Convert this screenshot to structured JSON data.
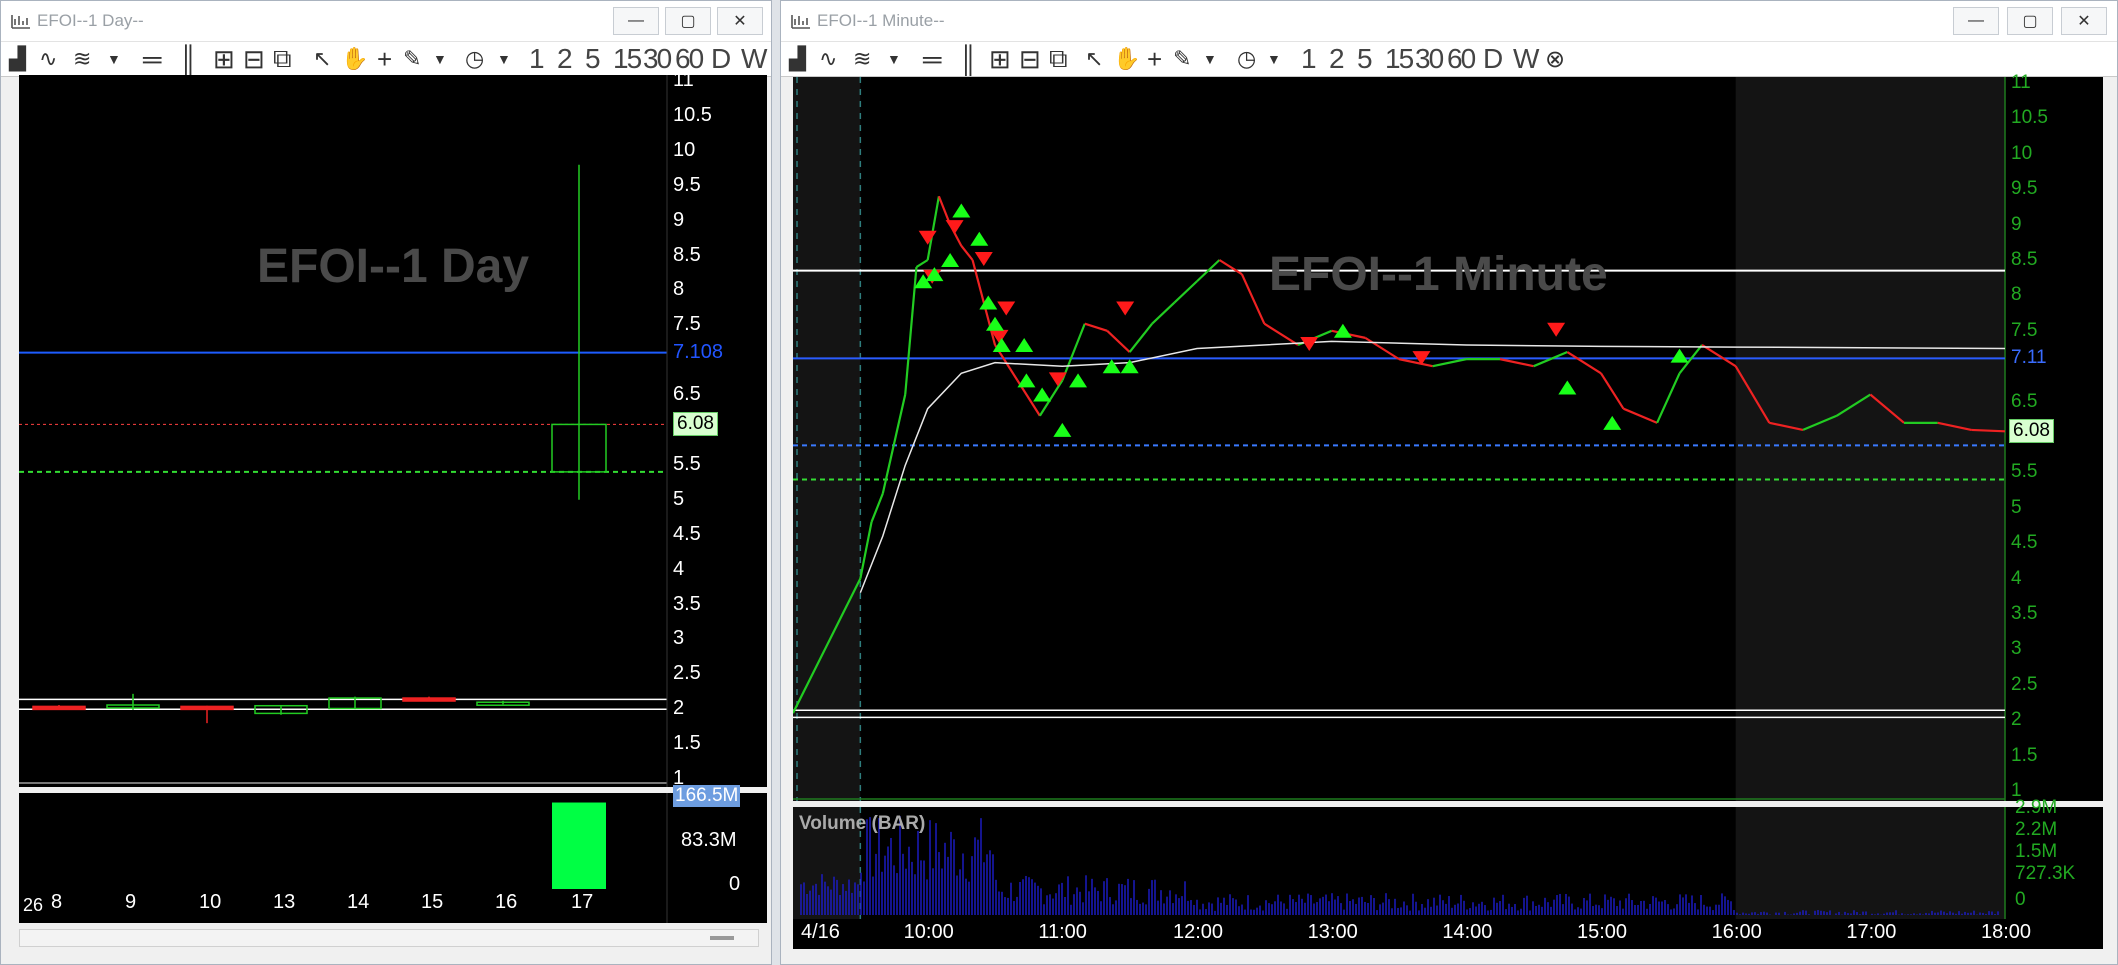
{
  "left": {
    "title": "EFOI--1 Day--",
    "watermark": "EFOI--1 Day",
    "intervals": [
      "1",
      "2",
      "5",
      "15",
      "30",
      "60",
      "D",
      "W"
    ],
    "price_ticks": [
      "11",
      "10.5",
      "10",
      "9.5",
      "9",
      "8.5",
      "8",
      "7.5",
      "7.108",
      "6.5",
      "6.08",
      "5.5",
      "5",
      "4.5",
      "4",
      "3.5",
      "3",
      "2.5",
      "2",
      "1.5",
      "1"
    ],
    "volume_ticks": [
      "166.5M",
      "83.3M",
      "0"
    ],
    "dates": [
      "26",
      "8",
      "9",
      "10",
      "13",
      "14",
      "15",
      "16",
      "17"
    ]
  },
  "right": {
    "title": "EFOI--1 Minute--",
    "watermark": "EFOI--1 Minute",
    "volume_label": "Volume (BAR)",
    "intervals": [
      "1",
      "2",
      "5",
      "15",
      "30",
      "60",
      "D",
      "W"
    ],
    "price_ticks": [
      "11",
      "10.5",
      "10",
      "9.5",
      "9",
      "8.5",
      "8",
      "7.5",
      "7.11",
      "6.5",
      "6.08",
      "5.5",
      "5",
      "4.5",
      "4",
      "3.5",
      "3",
      "2.5",
      "2",
      "1.5",
      "1"
    ],
    "volume_ticks": [
      "2.9M",
      "2.2M",
      "1.5M",
      "727.3K",
      "0"
    ],
    "times": [
      "4/16",
      "10:00",
      "11:00",
      "12:00",
      "13:00",
      "14:00",
      "15:00",
      "16:00",
      "17:00",
      "18:00"
    ]
  },
  "chart_data": [
    {
      "type": "candlestick",
      "title": "EFOI--1 Day",
      "categories": [
        "8",
        "9",
        "10",
        "13",
        "14",
        "15",
        "16",
        "17"
      ],
      "ohlc": [
        [
          2.04,
          2.06,
          2.0,
          2.02
        ],
        [
          2.02,
          2.22,
          1.99,
          2.06
        ],
        [
          2.04,
          2.05,
          1.8,
          2.02
        ],
        [
          1.94,
          2.04,
          1.92,
          2.05
        ],
        [
          2.01,
          2.18,
          2.0,
          2.16
        ],
        [
          2.16,
          2.18,
          2.12,
          2.12
        ],
        [
          2.08,
          2.12,
          2.07,
          2.1
        ],
        [
          5.4,
          9.8,
          5.0,
          6.08
        ]
      ],
      "volume": [
        0,
        0,
        0,
        0,
        0,
        0,
        0,
        160000000
      ],
      "ylim": [
        1,
        11
      ],
      "hlines": [
        7.108,
        6.08,
        5.4
      ]
    },
    {
      "type": "line",
      "title": "EFOI--1 Minute",
      "x": [
        "9:00",
        "9:30",
        "9:35",
        "9:40",
        "9:50",
        "9:55",
        "10:00",
        "10:05",
        "10:10",
        "10:15",
        "10:20",
        "10:30",
        "10:40",
        "10:50",
        "11:00",
        "11:10",
        "11:20",
        "11:30",
        "11:40",
        "11:50",
        "12:00",
        "12:10",
        "12:20",
        "12:30",
        "12:45",
        "13:00",
        "13:15",
        "13:30",
        "13:45",
        "14:00",
        "14:15",
        "14:30",
        "14:45",
        "15:00",
        "15:10",
        "15:25",
        "15:35",
        "15:45",
        "16:00",
        "16:15",
        "16:30",
        "16:45",
        "17:00",
        "17:15",
        "17:30",
        "17:45",
        "18:00"
      ],
      "y": [
        2.1,
        4.0,
        4.8,
        5.2,
        6.6,
        8.4,
        8.5,
        9.4,
        9.0,
        8.7,
        8.5,
        7.3,
        6.8,
        6.3,
        6.8,
        7.6,
        7.5,
        7.2,
        7.6,
        7.9,
        8.2,
        8.5,
        8.3,
        7.6,
        7.3,
        7.5,
        7.4,
        7.1,
        7.0,
        7.1,
        7.1,
        7.0,
        7.2,
        6.9,
        6.4,
        6.2,
        6.9,
        7.3,
        7.0,
        6.2,
        6.1,
        6.3,
        6.6,
        6.2,
        6.2,
        6.1,
        6.08
      ],
      "ylim": [
        1,
        11
      ],
      "hlines": [
        8.35,
        7.11,
        6.08,
        5.4,
        2.1
      ]
    }
  ]
}
